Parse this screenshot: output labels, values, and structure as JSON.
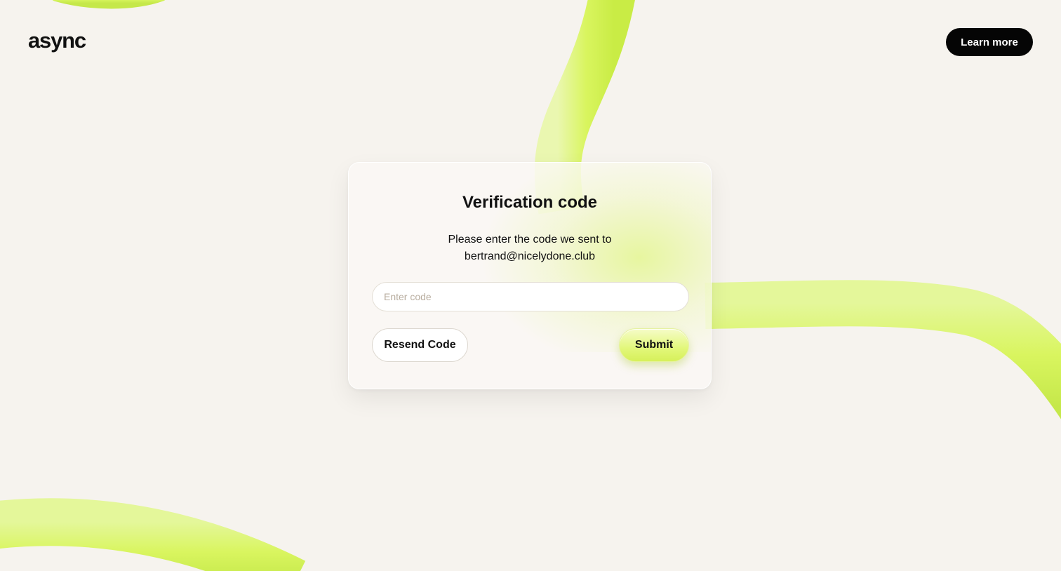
{
  "brand": {
    "logo_text": "async",
    "accent_color": "#d9f55f"
  },
  "header": {
    "learn_more_label": "Learn more"
  },
  "verification": {
    "title": "Verification code",
    "description_line1": "Please enter the code we sent to",
    "email": "bertrand@nicelydone.club",
    "code_input": {
      "value": "",
      "placeholder": "Enter code"
    },
    "resend_label": "Resend Code",
    "submit_label": "Submit"
  }
}
